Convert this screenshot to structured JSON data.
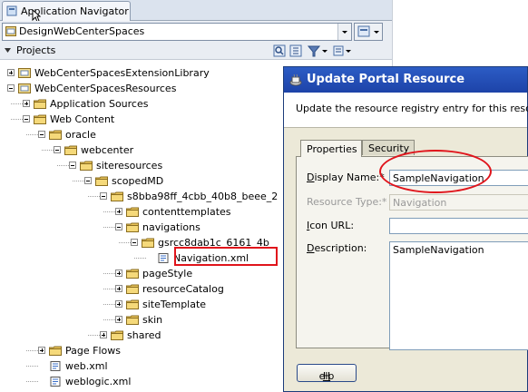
{
  "navigator": {
    "tab_title": "Application Navigator",
    "application": "DesignWebCenterSpaces",
    "projects_label": "Projects"
  },
  "tree": [
    {
      "label": "WebCenterSpacesExtensionLibrary",
      "icon": "project-folder-icon",
      "expander": "plus"
    },
    {
      "label": "WebCenterSpacesResources",
      "icon": "project-folder-icon",
      "expander": "minus"
    },
    {
      "label": "Application Sources",
      "icon": "folder-icon",
      "expander": "plus"
    },
    {
      "label": "Web Content",
      "icon": "folder-icon",
      "expander": "minus"
    },
    {
      "label": "oracle",
      "icon": "folder-icon",
      "expander": "minus"
    },
    {
      "label": "webcenter",
      "icon": "folder-icon",
      "expander": "minus"
    },
    {
      "label": "siteresources",
      "icon": "folder-icon",
      "expander": "minus"
    },
    {
      "label": "scopedMD",
      "icon": "folder-icon",
      "expander": "minus"
    },
    {
      "label": "s8bba98ff_4cbb_40b8_beee_2",
      "icon": "folder-icon",
      "expander": "minus"
    },
    {
      "label": "contenttemplates",
      "icon": "folder-icon",
      "expander": "plus"
    },
    {
      "label": "navigations",
      "icon": "folder-icon",
      "expander": "minus"
    },
    {
      "label": "gsrcc8dab1c_6161_4b",
      "icon": "folder-icon",
      "expander": "minus"
    },
    {
      "label": "Navigation.xml",
      "icon": "xml-file-icon",
      "expander": "none"
    },
    {
      "label": "pageStyle",
      "icon": "folder-icon",
      "expander": "plus"
    },
    {
      "label": "resourceCatalog",
      "icon": "folder-icon",
      "expander": "plus"
    },
    {
      "label": "siteTemplate",
      "icon": "folder-icon",
      "expander": "plus"
    },
    {
      "label": "skin",
      "icon": "folder-icon",
      "expander": "plus"
    },
    {
      "label": "shared",
      "icon": "folder-icon",
      "expander": "plus"
    },
    {
      "label": "Page Flows",
      "icon": "folder-icon",
      "expander": "plus"
    },
    {
      "label": "web.xml",
      "icon": "xml-file-icon",
      "expander": "none"
    },
    {
      "label": "weblogic.xml",
      "icon": "xml-file-icon",
      "expander": "none"
    }
  ],
  "dialog": {
    "title": "Update Portal Resource",
    "description": "Update the resource registry entry for this resource",
    "tabs": {
      "properties": "Properties",
      "security": "Security"
    },
    "fields": {
      "display_name": {
        "label_key": "D",
        "label_rest": "isplay Name:*",
        "value": "SampleNavigation"
      },
      "resource_type": {
        "label": "Resource Type:*",
        "value": "Navigation"
      },
      "icon_url": {
        "label_key": "I",
        "label_rest": "con URL:",
        "value": ""
      },
      "description": {
        "label_key": "D",
        "label_rest": "escription:",
        "value": "SampleNavigation"
      }
    },
    "help_key": "H",
    "help_rest": "elp"
  },
  "colors": {
    "dialog_title": "#1d43a8",
    "highlight": "#e0141b",
    "folder": "#e8c35a"
  }
}
